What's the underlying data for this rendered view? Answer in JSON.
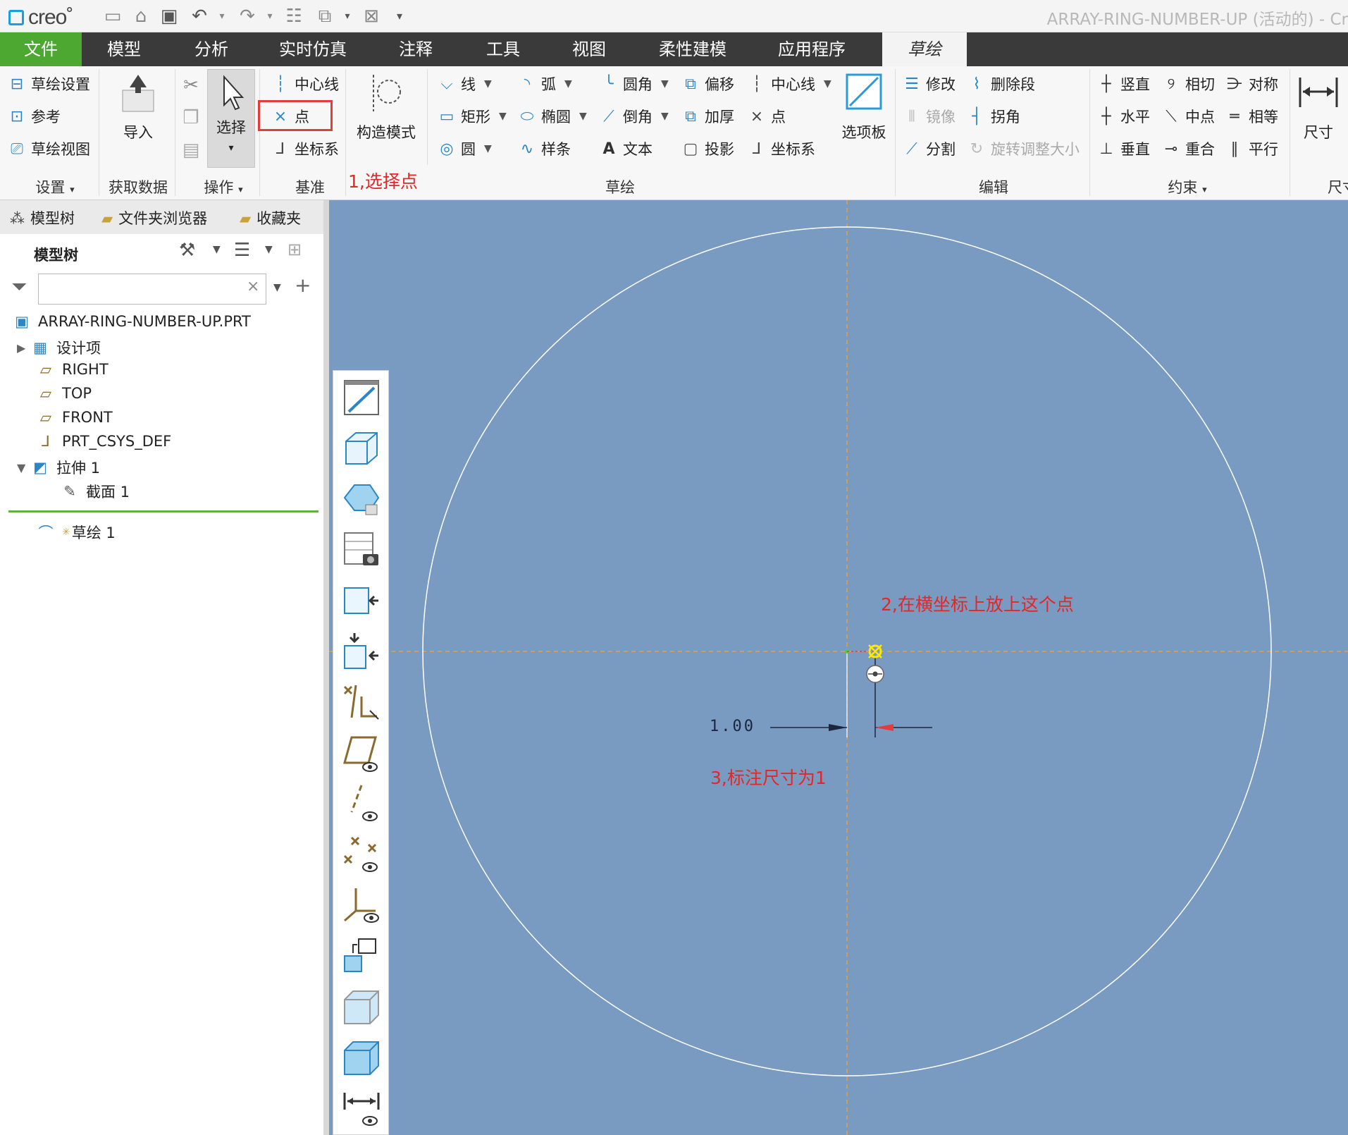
{
  "window": {
    "logo": "creo",
    "title": "ARRAY-RING-NUMBER-UP (活动的) - Cr"
  },
  "menu": {
    "tabs": [
      "文件",
      "模型",
      "分析",
      "实时仿真",
      "注释",
      "工具",
      "视图",
      "柔性建模",
      "应用程序",
      "草绘"
    ],
    "active": "草绘"
  },
  "ribbon": {
    "setup": {
      "items": [
        "草绘设置",
        "参考",
        "草绘视图"
      ],
      "group": "设置"
    },
    "getdata": {
      "import": "导入",
      "group": "获取数据"
    },
    "ops": {
      "select": "选择",
      "group": "操作"
    },
    "datum": {
      "items": [
        "中心线",
        "点",
        "坐标系"
      ],
      "group": "基准"
    },
    "construct": {
      "label": "构造模式"
    },
    "sketch": {
      "col1": [
        "线",
        "矩形",
        "圆"
      ],
      "col2": [
        "弧",
        "椭圆",
        "样条"
      ],
      "col3": [
        "圆角",
        "倒角",
        "文本"
      ],
      "col4": [
        "偏移",
        "加厚",
        "投影"
      ],
      "col5": [
        "中心线",
        "点",
        "坐标系"
      ],
      "palette": "选项板",
      "group": "草绘"
    },
    "edit": {
      "items": [
        "修改",
        "删除段",
        "镜像",
        "拐角",
        "分割",
        "旋转调整大小"
      ],
      "group": "编辑"
    },
    "constrain": {
      "items": [
        "竖直",
        "相切",
        "对称",
        "水平",
        "中点",
        "相等",
        "垂直",
        "重合",
        "平行"
      ],
      "group": "约束"
    },
    "dimension": {
      "label": "尺寸",
      "group": "尺寸"
    }
  },
  "panel": {
    "tabs": [
      "模型树",
      "文件夹浏览器",
      "收藏夹"
    ],
    "tree_header": "模型树",
    "filter_placeholder": "",
    "items": [
      "ARRAY-RING-NUMBER-UP.PRT",
      "设计项",
      "RIGHT",
      "TOP",
      "FRONT",
      "PRT_CSYS_DEF",
      "拉伸 1",
      "截面 1"
    ],
    "insert_item": "草绘 1"
  },
  "canvas": {
    "dimension_value": "1.00"
  },
  "annotations": {
    "step1": "1,选择点",
    "step2": "2,在横坐标上放上这个点",
    "step3": "3,标注尺寸为1"
  },
  "colors": {
    "accent_green": "#4ca831",
    "canvas_bg": "#7a9bc1",
    "annotation_red": "#e32626",
    "icon_blue": "#2b86c5"
  }
}
